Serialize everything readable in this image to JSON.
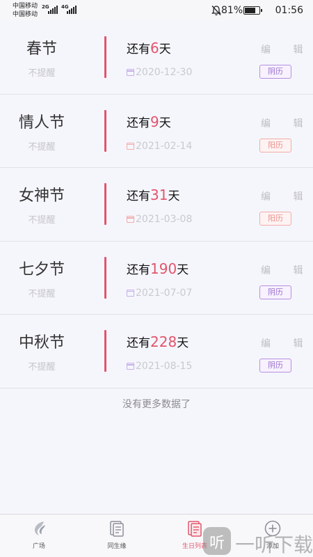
{
  "statusbar": {
    "carrier1": "中国移动",
    "carrier2": "中国移动",
    "net1": "2G",
    "net2": "4G",
    "battery_percent": "81%",
    "battery_level": 0.81,
    "time": "01:56"
  },
  "edit_label": "编 辑",
  "festivals": [
    {
      "name": "春节",
      "remind": "不提醒",
      "prefix": "还有",
      "days": "6",
      "suffix": "天",
      "date": "2020-12-30",
      "calendar": "阴历"
    },
    {
      "name": "情人节",
      "remind": "不提醒",
      "prefix": "还有",
      "days": "9",
      "suffix": "天",
      "date": "2021-02-14",
      "calendar": "阳历"
    },
    {
      "name": "女神节",
      "remind": "不提醒",
      "prefix": "还有",
      "days": "31",
      "suffix": "天",
      "date": "2021-03-08",
      "calendar": "阳历"
    },
    {
      "name": "七夕节",
      "remind": "不提醒",
      "prefix": "还有",
      "days": "190",
      "suffix": "天",
      "date": "2021-07-07",
      "calendar": "阴历"
    },
    {
      "name": "中秋节",
      "remind": "不提醒",
      "prefix": "还有",
      "days": "228",
      "suffix": "天",
      "date": "2021-08-15",
      "calendar": "阴历"
    }
  ],
  "no_more": "没有更多数据了",
  "nav": {
    "square": "广场",
    "same_birthday": "同生缘",
    "birthday_list": "生日列表",
    "add": "添加"
  },
  "watermark": {
    "logo": "听",
    "text": "一听下载"
  },
  "colors": {
    "accent": "#e3546b",
    "lunar": "#9b6fcf",
    "solar": "#ec8f8b"
  }
}
